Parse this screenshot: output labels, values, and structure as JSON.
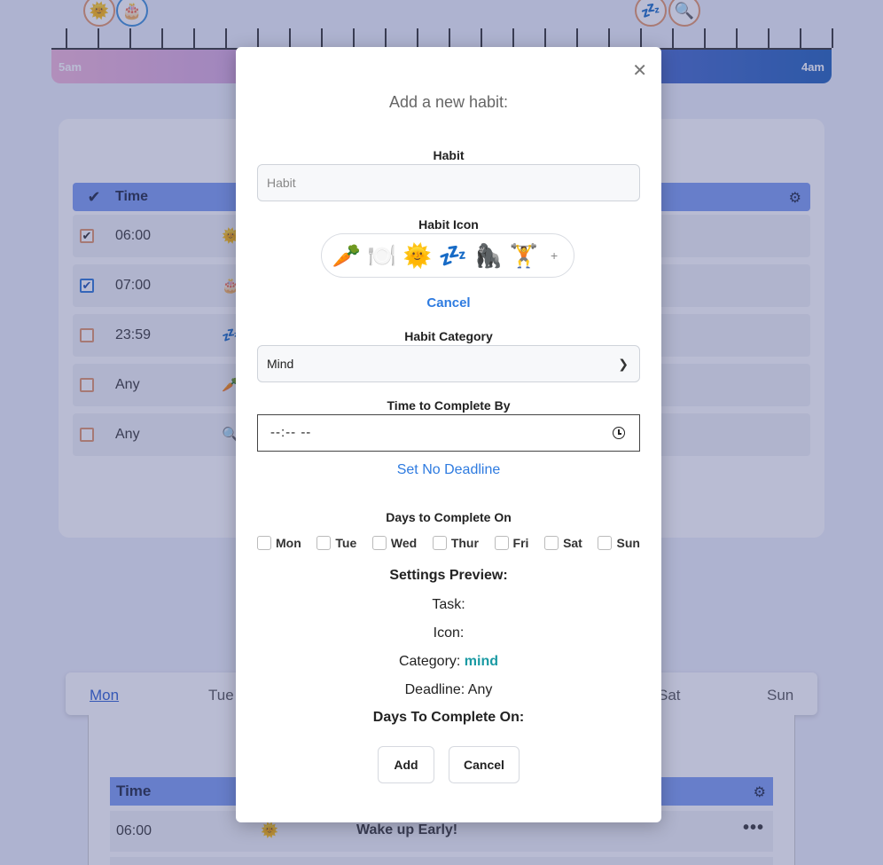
{
  "timeline": {
    "start_label": "5am",
    "end_label": "4am",
    "markers": [
      "sun-icon",
      "cake-icon",
      "sleep-icon",
      "magnifier-icon"
    ]
  },
  "habits_table": {
    "header": {
      "time": "Time"
    },
    "rows": [
      {
        "checked": true,
        "time": "06:00",
        "icon": "sun-icon"
      },
      {
        "checked": true,
        "time": "07:00",
        "icon": "cake-icon"
      },
      {
        "checked": false,
        "time": "23:59",
        "icon": "sleep-icon"
      },
      {
        "checked": false,
        "time": "Any",
        "icon": "carrot-icon"
      },
      {
        "checked": false,
        "time": "Any",
        "icon": "magnifier-icon"
      }
    ]
  },
  "week_tabs": [
    "Mon",
    "Tue",
    "Sat",
    "Sun"
  ],
  "day_table": {
    "header": {
      "time": "Time"
    },
    "rows": [
      {
        "time": "06:00",
        "icon": "sun-icon",
        "name": "Wake up Early!",
        "menu": "•••"
      }
    ]
  },
  "modal": {
    "title": "Add a new habit:",
    "close": "✕",
    "habit_label": "Habit",
    "habit_placeholder": "Habit",
    "habit_value": "",
    "icon_label": "Habit Icon",
    "icon_choices": [
      "🥕",
      "🍽️",
      "🌞",
      "💤",
      "🦍",
      "🏋️"
    ],
    "icon_more": "+",
    "icon_cancel": "Cancel",
    "category_label": "Habit Category",
    "category_value": "Mind",
    "time_label": "Time to Complete By",
    "time_value": "--:-- --",
    "no_deadline": "Set No Deadline",
    "days_label": "Days to Complete On",
    "days": [
      "Mon",
      "Tue",
      "Wed",
      "Thur",
      "Fri",
      "Sat",
      "Sun"
    ],
    "preview": {
      "title": "Settings Preview:",
      "task_label": "Task:",
      "icon_label": "Icon:",
      "category_label": "Category:",
      "category_value": "mind",
      "deadline_label": "Deadline:",
      "deadline_value": "Any",
      "days_label": "Days To Complete On:"
    },
    "add_button": "Add",
    "cancel_button": "Cancel"
  },
  "colors": {
    "accent": "#2e7be0",
    "table_header": "#7b9cf0",
    "category": "#1a9aa3"
  }
}
